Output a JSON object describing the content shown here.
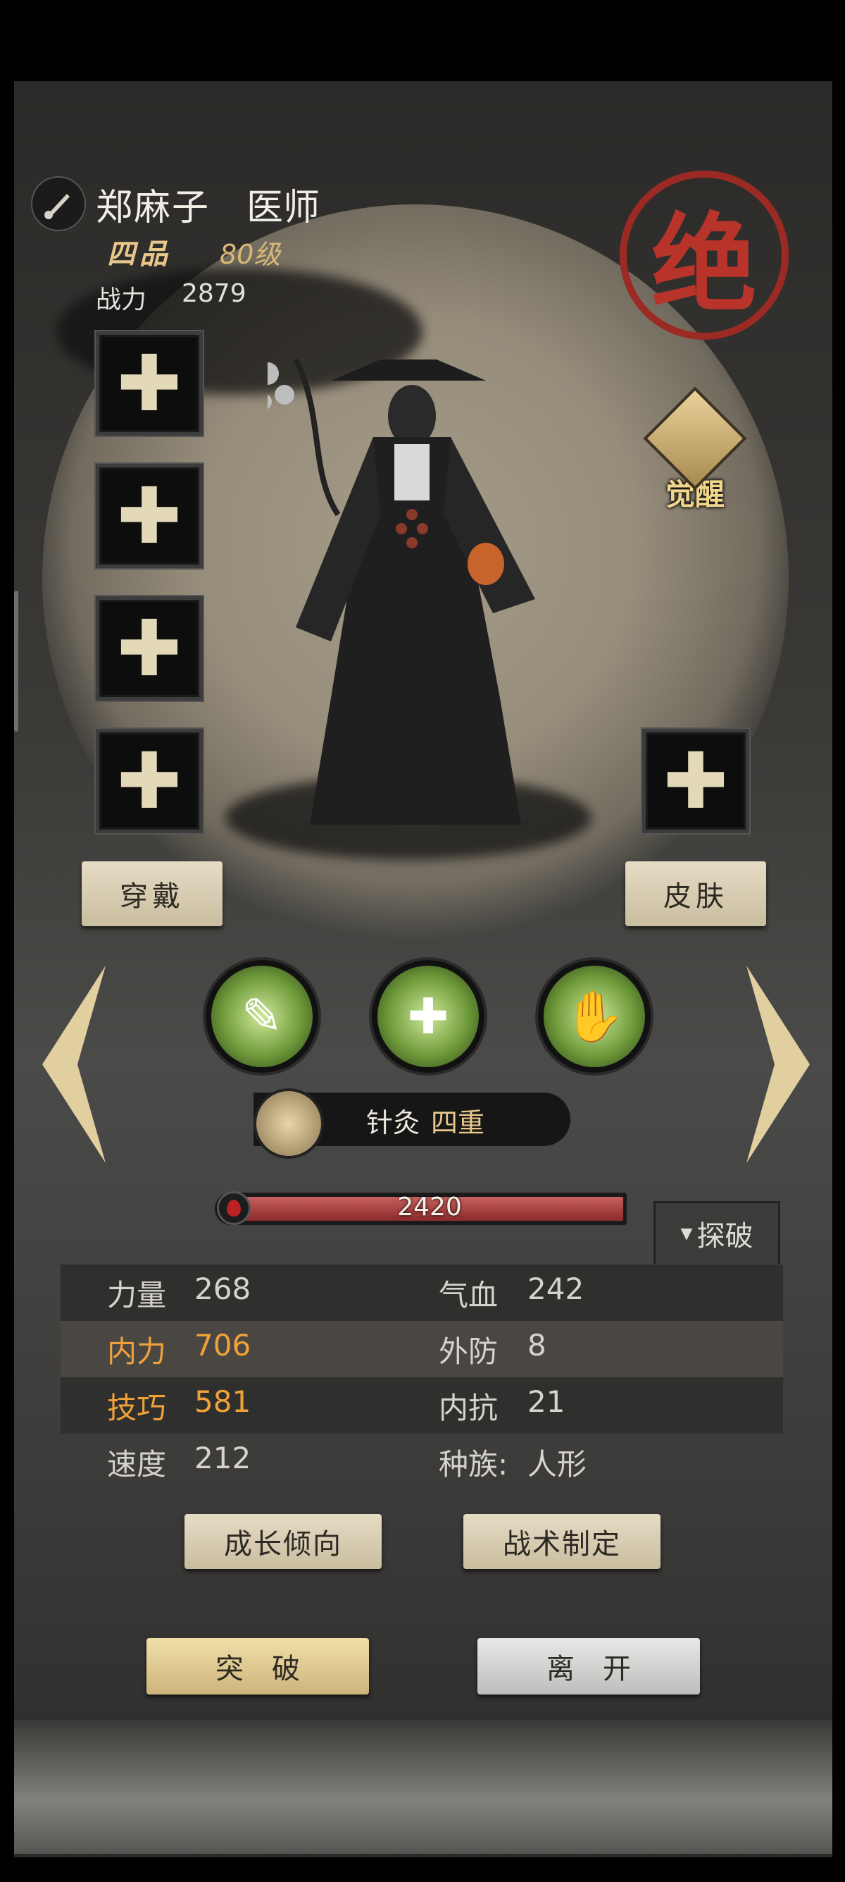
{
  "hero": {
    "name": "郑麻子",
    "class": "医师",
    "grade": "四品",
    "level": "80级",
    "power_label": "战力",
    "power": "2879",
    "rarity_seal": "绝",
    "awaken_label": "觉醒"
  },
  "buttons": {
    "wear": "穿戴",
    "skin": "皮肤",
    "growth": "成长倾向",
    "tactics": "战术制定",
    "breakthrough": "突破",
    "leave": "离开",
    "explore": "探破"
  },
  "skill": {
    "acupuncture_name": "针灸",
    "acupuncture_level": "四重"
  },
  "hp": {
    "value": "2420",
    "fill_fraction": 1.0
  },
  "stats": [
    {
      "left_key": "力量",
      "left_val": "268",
      "right_key": "气血",
      "right_val": "242",
      "row_style": "dark",
      "left_color": "grey"
    },
    {
      "left_key": "内力",
      "left_val": "706",
      "right_key": "外防",
      "right_val": "8",
      "row_style": "light",
      "left_color": "orange"
    },
    {
      "left_key": "技巧",
      "left_val": "581",
      "right_key": "内抗",
      "right_val": "21",
      "row_style": "dark",
      "left_color": "orange"
    },
    {
      "left_key": "速度",
      "left_val": "212",
      "right_key": "种族:",
      "right_val": "人形",
      "row_style": "none",
      "left_color": "grey"
    }
  ],
  "icons": {
    "header": "ink-brush-icon",
    "slot": "plus-icon",
    "awaken": "awaken-diamond-icon",
    "skills": [
      "needle-icon",
      "heal-cross-icon",
      "palm-icon"
    ],
    "explore": "dropdown-triangle-icon"
  },
  "colors": {
    "accent_gold": "#e8c78a",
    "accent_orange": "#f0a13a",
    "seal_red": "#b8342b",
    "hp_red": "#a63a3a",
    "skill_green": "#6f9b3a"
  }
}
